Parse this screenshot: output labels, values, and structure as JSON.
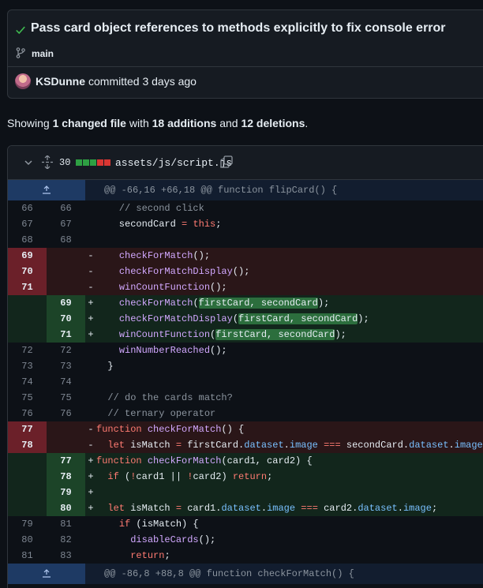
{
  "commit": {
    "title": "Pass card object references to methods explicitly to fix console error",
    "branch": "main",
    "author": "KSDunne",
    "committed_text": "committed 3 days ago"
  },
  "summary": {
    "prefix": "Showing ",
    "changed": "1 changed file",
    "with": " with ",
    "additions": "18 additions",
    "and": " and ",
    "deletions": "12 deletions",
    "suffix": "."
  },
  "file": {
    "changes_count": "30",
    "path": "assets/js/script.js",
    "diffstat": [
      "add",
      "add",
      "add",
      "del",
      "del"
    ]
  },
  "colors": {
    "addition": "#2ea043",
    "deletion": "#da3633"
  },
  "hunks": [
    "@@ -66,16 +66,18 @@ function flipCard() {",
    "@@ -86,8 +88,8 @@ function checkForMatch() {"
  ],
  "lines": [
    {
      "old": "66",
      "new": "66",
      "sign": " ",
      "code": "    // second click"
    },
    {
      "old": "67",
      "new": "67",
      "sign": " ",
      "code": "    secondCard = this;"
    },
    {
      "old": "68",
      "new": "68",
      "sign": " ",
      "code": ""
    },
    {
      "old": "69",
      "new": "",
      "sign": "-",
      "code": "    checkForMatch();"
    },
    {
      "old": "70",
      "new": "",
      "sign": "-",
      "code": "    checkForMatchDisplay();"
    },
    {
      "old": "71",
      "new": "",
      "sign": "-",
      "code": "    winCountFunction();"
    },
    {
      "old": "",
      "new": "69",
      "sign": "+",
      "code": "    checkForMatch(firstCard, secondCard);"
    },
    {
      "old": "",
      "new": "70",
      "sign": "+",
      "code": "    checkForMatchDisplay(firstCard, secondCard);"
    },
    {
      "old": "",
      "new": "71",
      "sign": "+",
      "code": "    winCountFunction(firstCard, secondCard);"
    },
    {
      "old": "72",
      "new": "72",
      "sign": " ",
      "code": "    winNumberReached();"
    },
    {
      "old": "73",
      "new": "73",
      "sign": " ",
      "code": "  }"
    },
    {
      "old": "74",
      "new": "74",
      "sign": " ",
      "code": ""
    },
    {
      "old": "75",
      "new": "75",
      "sign": " ",
      "code": "  // do the cards match?"
    },
    {
      "old": "76",
      "new": "76",
      "sign": " ",
      "code": "  // ternary operator"
    },
    {
      "old": "77",
      "new": "",
      "sign": "-",
      "code": "function checkForMatch() {"
    },
    {
      "old": "78",
      "new": "",
      "sign": "-",
      "code": "  let isMatch = firstCard.dataset.image === secondCard.dataset.image;"
    },
    {
      "old": "",
      "new": "77",
      "sign": "+",
      "code": "function checkForMatch(card1, card2) {"
    },
    {
      "old": "",
      "new": "78",
      "sign": "+",
      "code": "  if (!card1 || !card2) return;"
    },
    {
      "old": "",
      "new": "79",
      "sign": "+",
      "code": ""
    },
    {
      "old": "",
      "new": "80",
      "sign": "+",
      "code": "  let isMatch = card1.dataset.image === card2.dataset.image;"
    },
    {
      "old": "79",
      "new": "81",
      "sign": " ",
      "code": "    if (isMatch) {"
    },
    {
      "old": "80",
      "new": "82",
      "sign": " ",
      "code": "      disableCards();"
    },
    {
      "old": "81",
      "new": "83",
      "sign": " ",
      "code": "      return;"
    }
  ]
}
